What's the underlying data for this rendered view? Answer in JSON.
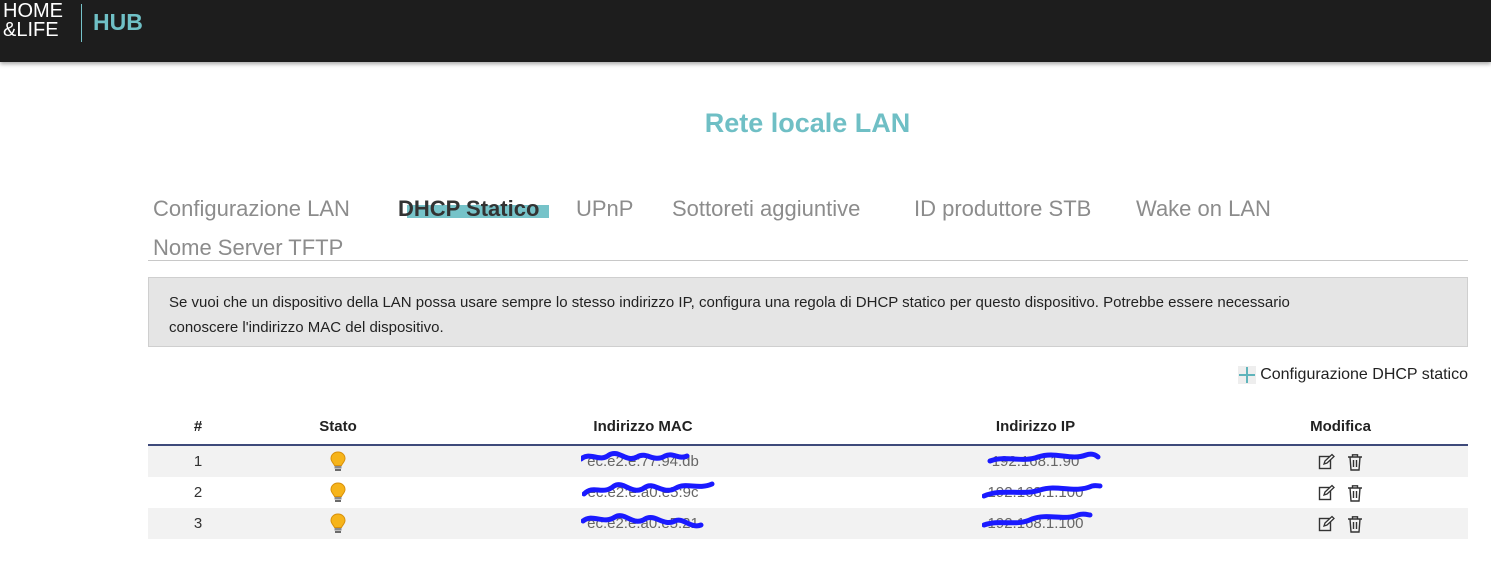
{
  "brand": {
    "line1": "HOME",
    "line2": "&LIFE",
    "hub": "HUB"
  },
  "page": {
    "title": "Rete locale LAN"
  },
  "tabs": [
    {
      "label": "Configurazione LAN",
      "active": false
    },
    {
      "label": "DHCP Statico",
      "active": true
    },
    {
      "label": "UPnP",
      "active": false
    },
    {
      "label": "Sottoreti aggiuntive",
      "active": false
    },
    {
      "label": "ID produttore STB",
      "active": false
    },
    {
      "label": "Wake on LAN",
      "active": false
    },
    {
      "label": "Nome Server TFTP",
      "active": false
    }
  ],
  "info": {
    "line1": "Se vuoi che un dispositivo della LAN possa usare sempre lo stesso indirizzo IP, configura una regola di DHCP statico per questo dispositivo. Potrebbe essere necessario",
    "line2": "conoscere l'indirizzo MAC del dispositivo."
  },
  "actions": {
    "add_label": "Configurazione DHCP statico",
    "add_icon": "plus-icon"
  },
  "table": {
    "headers": {
      "num": "#",
      "stato": "Stato",
      "mac": "Indirizzo MAC",
      "ip": "Indirizzo IP",
      "modifica": "Modifica"
    },
    "rows": [
      {
        "num": "1",
        "stato_icon": "lightbulb-icon",
        "mac": "ec:e2:e:77:94:db",
        "ip": "192.168.1.90"
      },
      {
        "num": "2",
        "stato_icon": "lightbulb-icon",
        "mac": "ec:e2:e:a0:e5:9c",
        "ip": "192.168.1.100"
      },
      {
        "num": "3",
        "stato_icon": "lightbulb-icon",
        "mac": "ec:e2:e:a0:e5:21",
        "ip": "192.168.1.100"
      }
    ]
  },
  "colors": {
    "accent": "#6fbfc5",
    "topbar": "#1d1d1d",
    "header_rule": "#3e4a7a",
    "redaction": "#1a1aff"
  }
}
